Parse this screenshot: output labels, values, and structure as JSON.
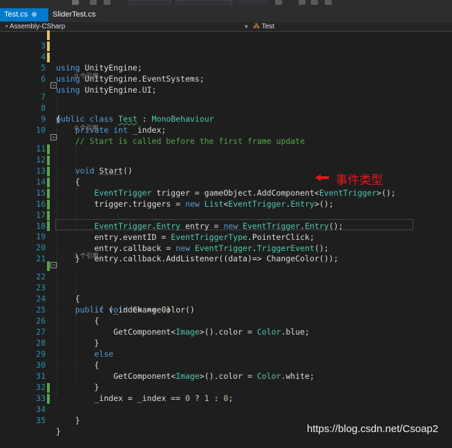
{
  "tabs": [
    {
      "label": "Test.cs",
      "pin_icon": "pin-icon",
      "close_icon": "close-icon"
    },
    {
      "label": "SliderTest.cs"
    }
  ],
  "navbar": {
    "project": "Assembly-CSharp",
    "class": "Test"
  },
  "editor": {
    "lines": [
      {
        "n": "3",
        "text": "using UnityEngine;"
      },
      {
        "n": "4",
        "text": "using UnityEngine.EventSystems;"
      },
      {
        "n": "5",
        "text": "using UnityEngine.UI;"
      },
      {
        "n": "6",
        "text": ""
      },
      {
        "n": "7",
        "text": "public class Test : MonoBehaviour"
      },
      {
        "n": "8",
        "text": "{"
      },
      {
        "n": "9",
        "text": "    private int _index;"
      },
      {
        "n": "10",
        "text": "    // Start is called before the first frame update"
      },
      {
        "n": "11",
        "text": "    void Start()"
      },
      {
        "n": "12",
        "text": "    {"
      },
      {
        "n": "13",
        "text": "        EventTrigger trigger = gameObject.AddComponent<EventTrigger>();"
      },
      {
        "n": "14",
        "text": "        trigger.triggers = new List<EventTrigger.Entry>();"
      },
      {
        "n": "15",
        "text": ""
      },
      {
        "n": "16",
        "text": "        EventTrigger.Entry entry = new EventTrigger.Entry();"
      },
      {
        "n": "17",
        "text": "        entry.eventID = EventTriggerType.PointerClick;"
      },
      {
        "n": "18",
        "text": "        entry.callback = new EventTrigger.TriggerEvent();"
      },
      {
        "n": "19",
        "text": "        entry.callback.AddListener((data)=> ChangeColor());"
      },
      {
        "n": "20",
        "text": "    }"
      },
      {
        "n": "21",
        "text": ""
      },
      {
        "n": "22",
        "text": "    public void ChangeColor()"
      },
      {
        "n": "23",
        "text": "    {"
      },
      {
        "n": "24",
        "text": "        if (_index == 0)"
      },
      {
        "n": "25",
        "text": "        {"
      },
      {
        "n": "26",
        "text": "            GetComponent<Image>().color = Color.blue;"
      },
      {
        "n": "27",
        "text": "        }"
      },
      {
        "n": "28",
        "text": "        else"
      },
      {
        "n": "29",
        "text": "        {"
      },
      {
        "n": "30",
        "text": "            GetComponent<Image>().color = Color.white;"
      },
      {
        "n": "31",
        "text": "        }"
      },
      {
        "n": "32",
        "text": "        _index = _index == 0 ? 1 : 0;"
      },
      {
        "n": "33",
        "text": "    }"
      },
      {
        "n": "34",
        "text": "}"
      },
      {
        "n": "35",
        "text": ""
      }
    ],
    "codelens": {
      "class_refs": "0 个引用",
      "start_refs": "0 个引用",
      "changecolor_refs": "1 个引用"
    }
  },
  "annotation": {
    "text": "事件类型",
    "color": "#e8161b"
  },
  "watermark": "https://blog.csdn.net/Csoap2",
  "colors": {
    "accent": "#007acc",
    "keyword": "#569cd6",
    "type": "#4ec9b0",
    "comment": "#57a64a",
    "line_number": "#2b91af"
  }
}
